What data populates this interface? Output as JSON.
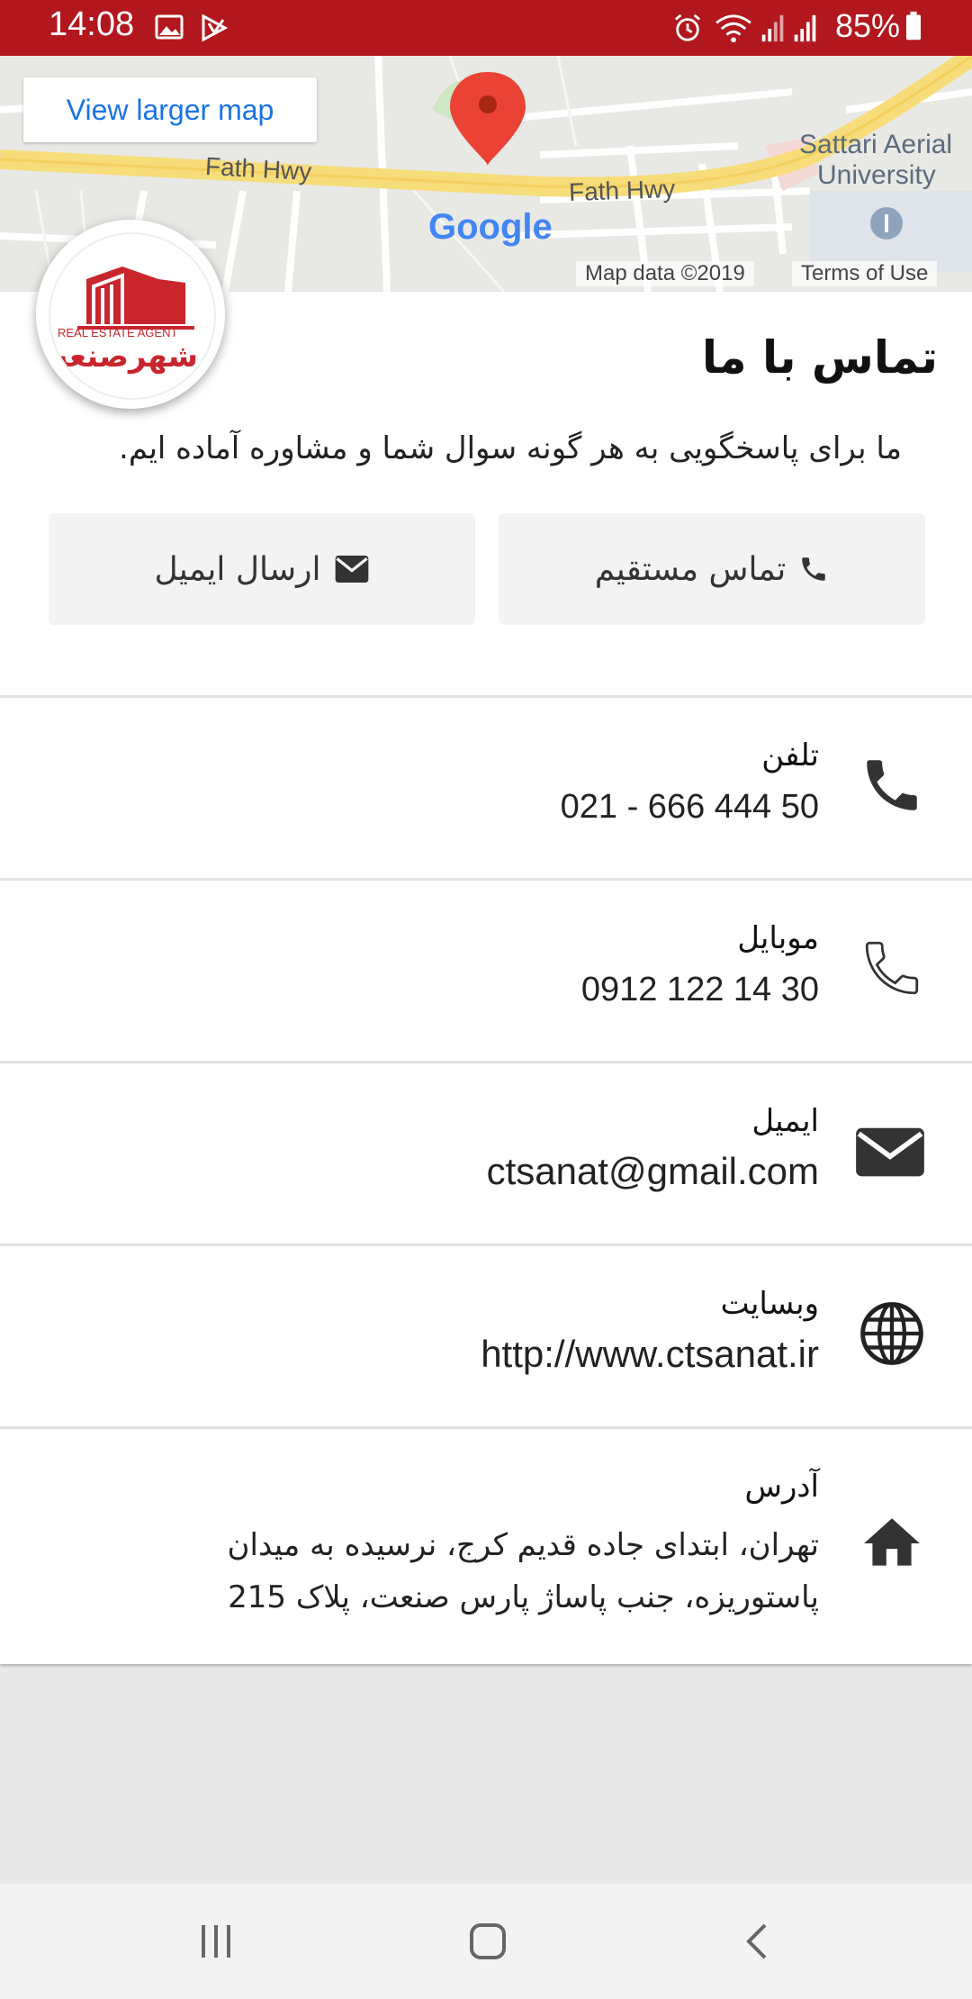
{
  "status_bar": {
    "time": "14:08",
    "battery": "85%",
    "icons": [
      "gallery-icon",
      "play-store-icon",
      "alarm-icon",
      "wifi-icon",
      "signal-icon",
      "signal-icon",
      "battery-icon"
    ]
  },
  "map": {
    "view_larger": "View larger map",
    "road_label_1": "Fath Hwy",
    "road_label_2": "Fath Hwy",
    "poi_line1": "Sattari Aerial",
    "poi_line2": "University",
    "google": "Google",
    "map_data": "Map data ©2019",
    "terms": "Terms of Use"
  },
  "contact": {
    "title": "تماس با ما",
    "subtitle": "ما برای پاسخگویی به هر گونه سوال شما و مشاوره آماده ایم.",
    "btn_call": "تماس مستقیم",
    "btn_email": "ارسال ایمیل",
    "rows": {
      "phone_label": "تلفن",
      "phone_value": "021 - 666 444 50",
      "mobile_label": "موبایل",
      "mobile_value": "0912 122 14 30",
      "email_label": "ایمیل",
      "email_value": "ctsanat@gmail.com",
      "website_label": "وبسایت",
      "website_value": "http://www.ctsanat.ir",
      "address_label": "آدرس",
      "address_line1": "تهران، ابتدای جاده قدیم کرج، نرسیده به میدان",
      "address_line2": "پاستوریزه، جنب پاساژ پارس صنعت، پلاک 215"
    }
  },
  "logo": {
    "text": "شهرصنعت",
    "small": "REAL ESTATE AGENT"
  },
  "colors": {
    "status_bar": "#b3171e",
    "link": "#1a73e8",
    "icon": "#333333"
  }
}
